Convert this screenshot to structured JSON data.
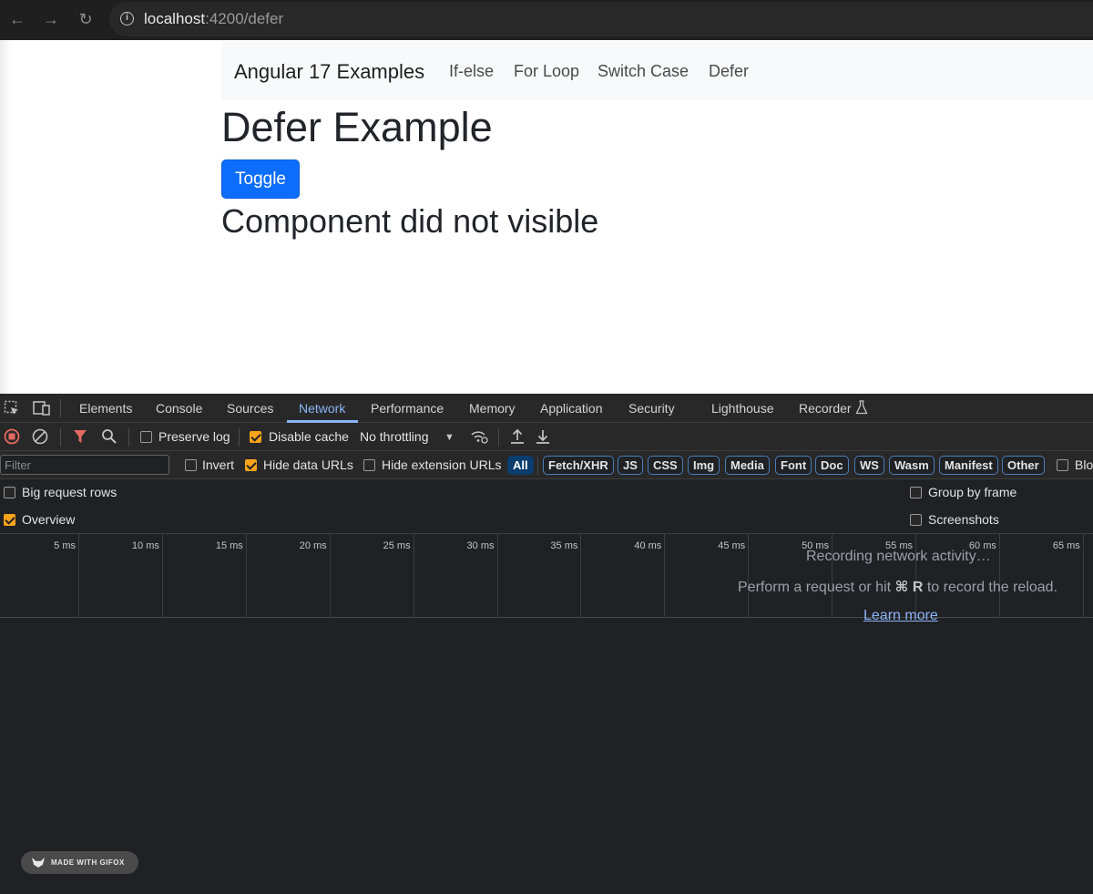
{
  "browser": {
    "back_glyph": "←",
    "forward_glyph": "→",
    "reload_glyph": "↻",
    "url_host": "localhost",
    "url_rest": ":4200/defer"
  },
  "app": {
    "brand": "Angular 17 Examples",
    "nav": [
      "If-else",
      "For Loop",
      "Switch Case",
      "Defer"
    ],
    "title": "Defer Example",
    "toggle_label": "Toggle",
    "status": "Component did not visible"
  },
  "devtools": {
    "tabs": [
      "Elements",
      "Console",
      "Sources",
      "Network",
      "Performance",
      "Memory",
      "Application",
      "Security",
      "Lighthouse",
      "Recorder"
    ],
    "active_tab": "Network",
    "toolbar": {
      "preserve_log": "Preserve log",
      "disable_cache": "Disable cache",
      "throttling": "No throttling"
    },
    "filter": {
      "placeholder": "Filter",
      "invert": "Invert",
      "hide_data_urls": "Hide data URLs",
      "hide_extension_urls": "Hide extension URLs",
      "types": [
        "All",
        "Fetch/XHR",
        "JS",
        "CSS",
        "Img",
        "Media",
        "Font",
        "Doc",
        "WS",
        "Wasm",
        "Manifest",
        "Other"
      ],
      "blocked_truncated": "Blo"
    },
    "settings": {
      "big_request_rows": "Big request rows",
      "overview": "Overview",
      "group_by_frame": "Group by frame",
      "screenshots": "Screenshots"
    },
    "timeline_ticks": [
      "5 ms",
      "10 ms",
      "15 ms",
      "20 ms",
      "25 ms",
      "30 ms",
      "35 ms",
      "40 ms",
      "45 ms",
      "50 ms",
      "55 ms",
      "60 ms",
      "65 ms"
    ],
    "empty": {
      "title": "Recording network activity…",
      "hint_prefix": "Perform a request or hit",
      "hint_keys": "⌘ R",
      "hint_suffix": "to record the reload.",
      "learn_more": "Learn more"
    },
    "accent_color": "#8ab4f8",
    "checkbox_color": "#f9a41b"
  },
  "watermark": {
    "text": "MADE WITH GIFOX"
  }
}
